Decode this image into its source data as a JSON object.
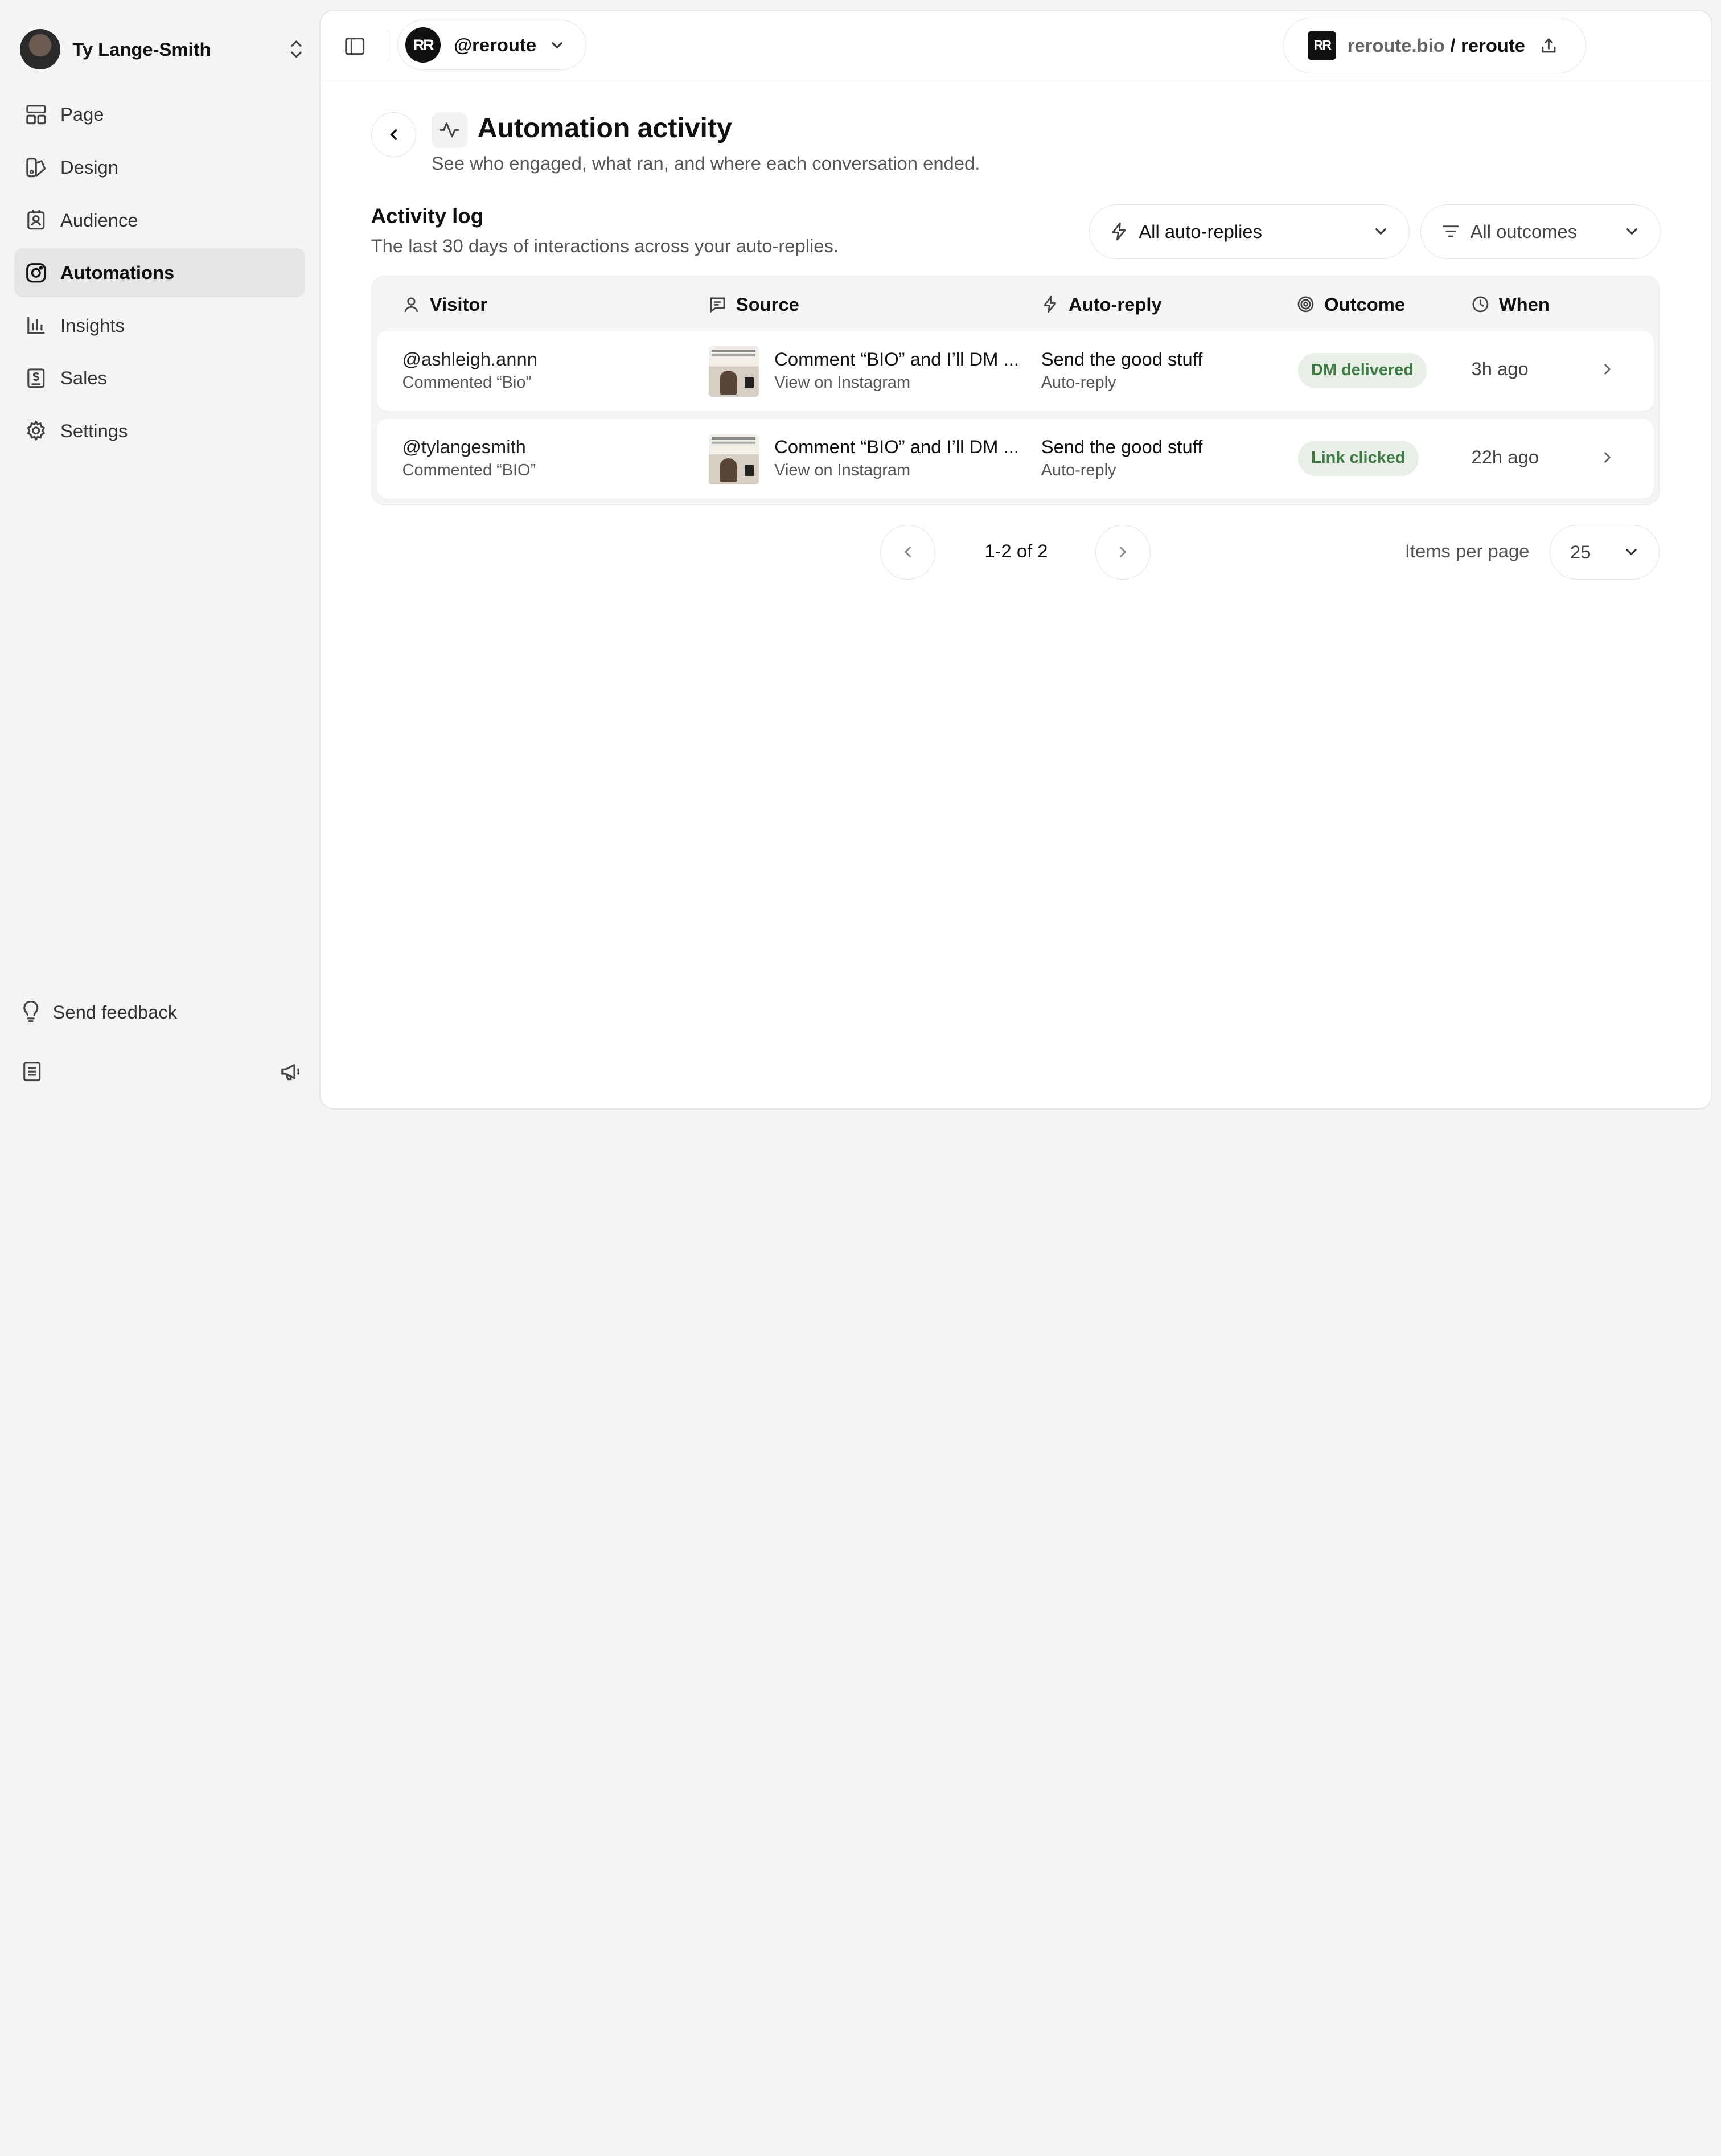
{
  "sidebar": {
    "user_name": "Ty Lange-Smith",
    "items": [
      {
        "label": "Page",
        "icon": "layout-icon"
      },
      {
        "label": "Design",
        "icon": "palette-icon"
      },
      {
        "label": "Audience",
        "icon": "contact-icon"
      },
      {
        "label": "Automations",
        "icon": "instagram-icon",
        "active": true
      },
      {
        "label": "Insights",
        "icon": "bar-chart-icon"
      },
      {
        "label": "Sales",
        "icon": "receipt-icon"
      },
      {
        "label": "Settings",
        "icon": "gear-icon"
      }
    ],
    "feedback_label": "Send feedback"
  },
  "topbar": {
    "account_logo": "RR",
    "account_handle": "@reroute",
    "url_domain": "reroute.bio",
    "url_separator": "/",
    "url_handle": "reroute"
  },
  "header": {
    "title": "Automation activity",
    "subtitle": "See who engaged, what ran, and where each conversation ended."
  },
  "activity": {
    "title": "Activity log",
    "subtitle": "The last 30 days of interactions across your auto-replies.",
    "filter_replies": "All auto-replies",
    "filter_outcomes": "All outcomes",
    "columns": [
      "Visitor",
      "Source",
      "Auto-reply",
      "Outcome",
      "When"
    ],
    "rows": [
      {
        "visitor": "@ashleigh.annn",
        "visitor_sub": "Commented “Bio”",
        "source": "Comment “BIO” and I’ll DM ...",
        "source_sub": "View on Instagram",
        "reply": "Send the good stuff",
        "reply_sub": "Auto-reply",
        "outcome": "DM delivered",
        "when": "3h ago"
      },
      {
        "visitor": "@tylangesmith",
        "visitor_sub": "Commented “BIO”",
        "source": "Comment “BIO” and I’ll DM ...",
        "source_sub": "View on Instagram",
        "reply": "Send the good stuff",
        "reply_sub": "Auto-reply",
        "outcome": "Link clicked",
        "when": "22h ago"
      }
    ]
  },
  "pagination": {
    "range": "1-2 of 2",
    "items_per_page_label": "Items per page",
    "items_per_page": "25"
  },
  "colors": {
    "accent_bg": "#e7efe6",
    "accent_text": "#3f7a45"
  }
}
